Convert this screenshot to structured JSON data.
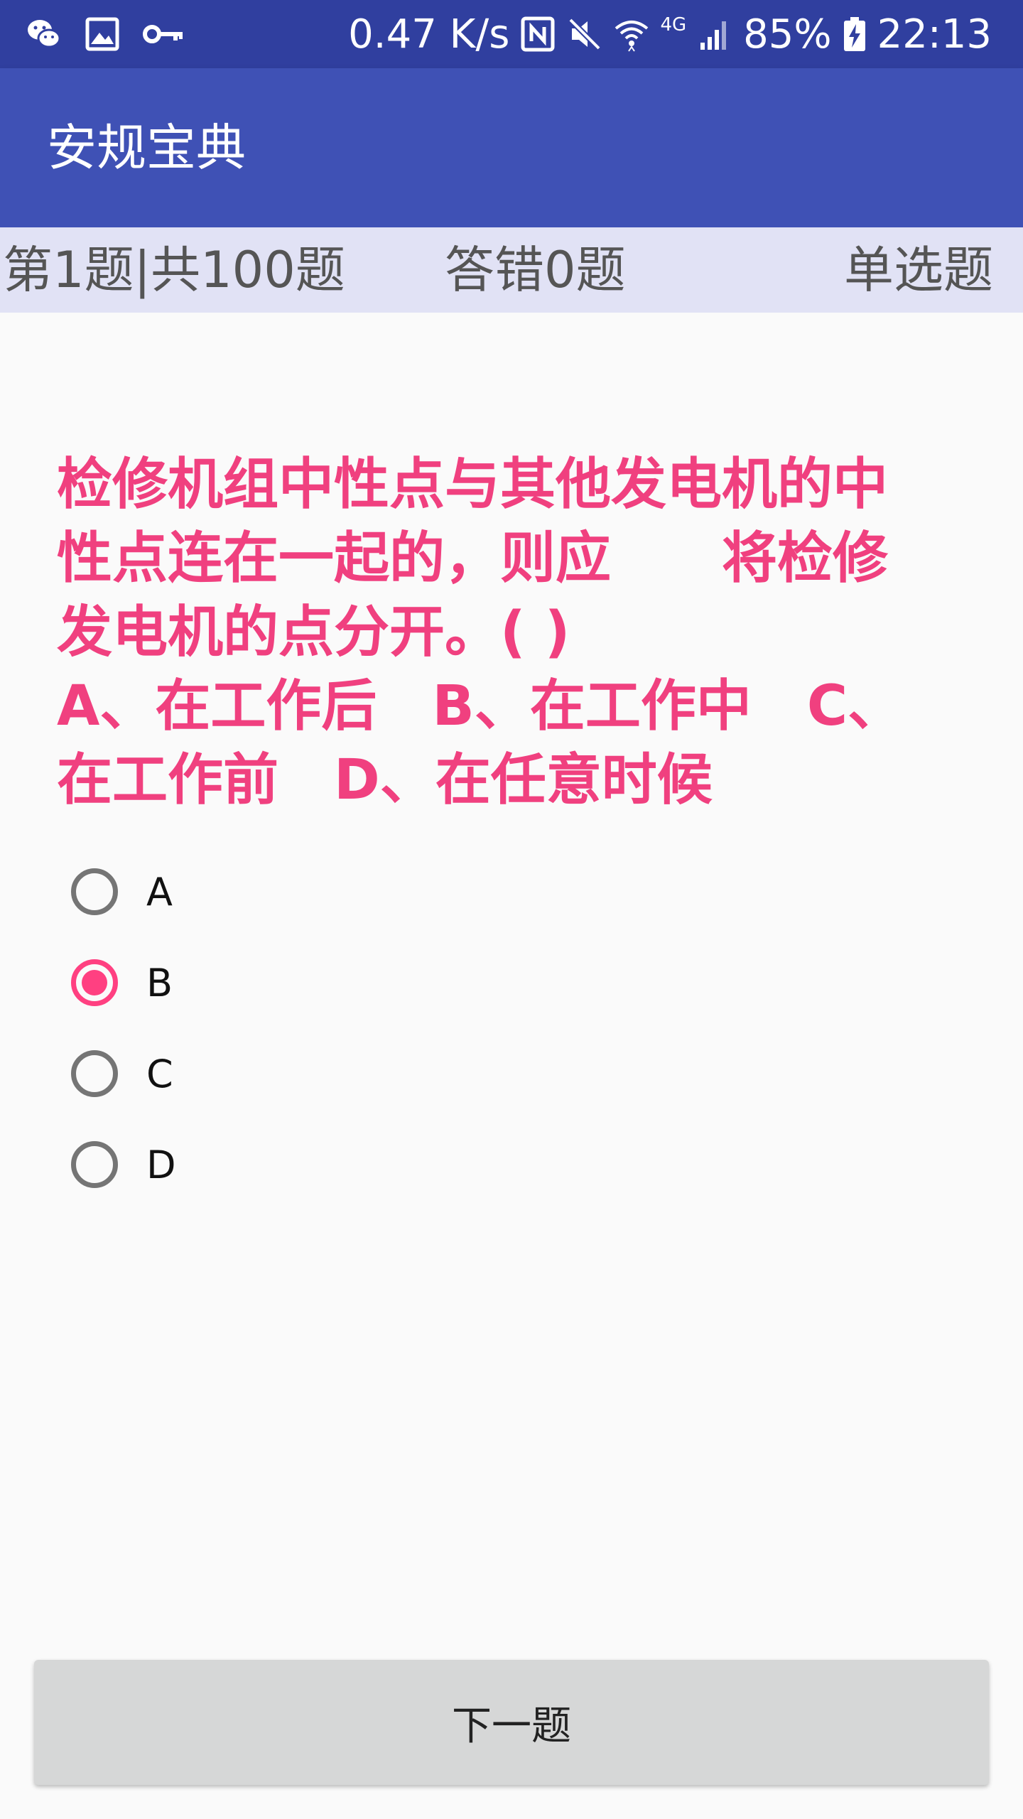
{
  "status_bar": {
    "net_speed": "0.47 K/s",
    "signal_type": "4G",
    "battery": "85%",
    "time": "22:13",
    "icons_left": [
      "wechat-icon",
      "image-icon",
      "key-icon"
    ],
    "icons_right": [
      "nfc-icon",
      "mute-icon",
      "wifi-icon",
      "signal-icon",
      "battery-charging-icon"
    ]
  },
  "app_bar": {
    "title": "安规宝典"
  },
  "info": {
    "progress": "第1题|共100题",
    "wrong": "答错0题",
    "type": "单选题"
  },
  "question": {
    "lines": [
      "检修机组中性点与其他发电机的中",
      "性点连在一起的，则应　　将检修",
      "发电机的点分开。(  )",
      "A、在工作后　B、在工作中　C、",
      "在工作前　D、在任意时候"
    ]
  },
  "options": [
    {
      "label": "A",
      "selected": false
    },
    {
      "label": "B",
      "selected": true
    },
    {
      "label": "C",
      "selected": false
    },
    {
      "label": "D",
      "selected": false
    }
  ],
  "next_button": {
    "label": "下一题"
  },
  "colors": {
    "status_bar": "#303f9f",
    "app_bar": "#3f51b5",
    "info_bar": "#e1e2f5",
    "accent": "#ff4081",
    "question_text": "#f0407f"
  }
}
